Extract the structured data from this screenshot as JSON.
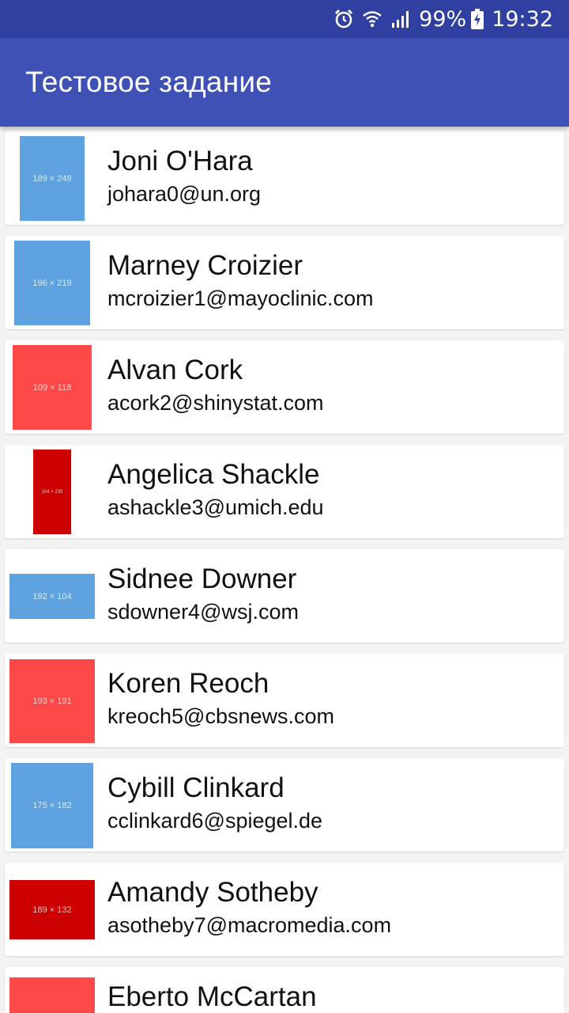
{
  "status": {
    "battery": "99%",
    "time": "19:32",
    "icons": [
      "alarm-icon",
      "wifi-icon",
      "signal-icon",
      "battery-charging-icon"
    ]
  },
  "appbar": {
    "title": "Тестовое задание"
  },
  "colors": {
    "status_bar": "#3040a0",
    "app_bar": "#3f51b5",
    "blue": "#5ea3e0",
    "red": "#ff4848",
    "dark_red": "#cc0000"
  },
  "contacts": [
    {
      "name": "Joni O'Hara",
      "email": "johara0@un.org",
      "image_label": "189 × 249",
      "color": "#5ea3e0"
    },
    {
      "name": "Marney Croizier",
      "email": "mcroizier1@mayoclinic.com",
      "image_label": "196 × 219",
      "color": "#5ea3e0"
    },
    {
      "name": "Alvan Cork",
      "email": "acork2@shinystat.com",
      "image_label": "109 × 118",
      "color": "#ff4848"
    },
    {
      "name": "Angelica Shackle",
      "email": "ashackle3@umich.edu",
      "image_label": "104 × 235",
      "color": "#cc0000"
    },
    {
      "name": "Sidnee Downer",
      "email": "sdowner4@wsj.com",
      "image_label": "192 × 104",
      "color": "#5ea3e0"
    },
    {
      "name": "Koren Reoch",
      "email": "kreoch5@cbsnews.com",
      "image_label": "193 × 191",
      "color": "#ff4848"
    },
    {
      "name": "Cybill Clinkard",
      "email": "cclinkard6@spiegel.de",
      "image_label": "175 × 182",
      "color": "#5ea3e0"
    },
    {
      "name": "Amandy Sotheby",
      "email": "asotheby7@macromedia.com",
      "image_label": "189 × 132",
      "color": "#cc0000"
    },
    {
      "name": "Eberto McCartan",
      "email": "",
      "image_label": "",
      "color": "#ff4848"
    }
  ]
}
